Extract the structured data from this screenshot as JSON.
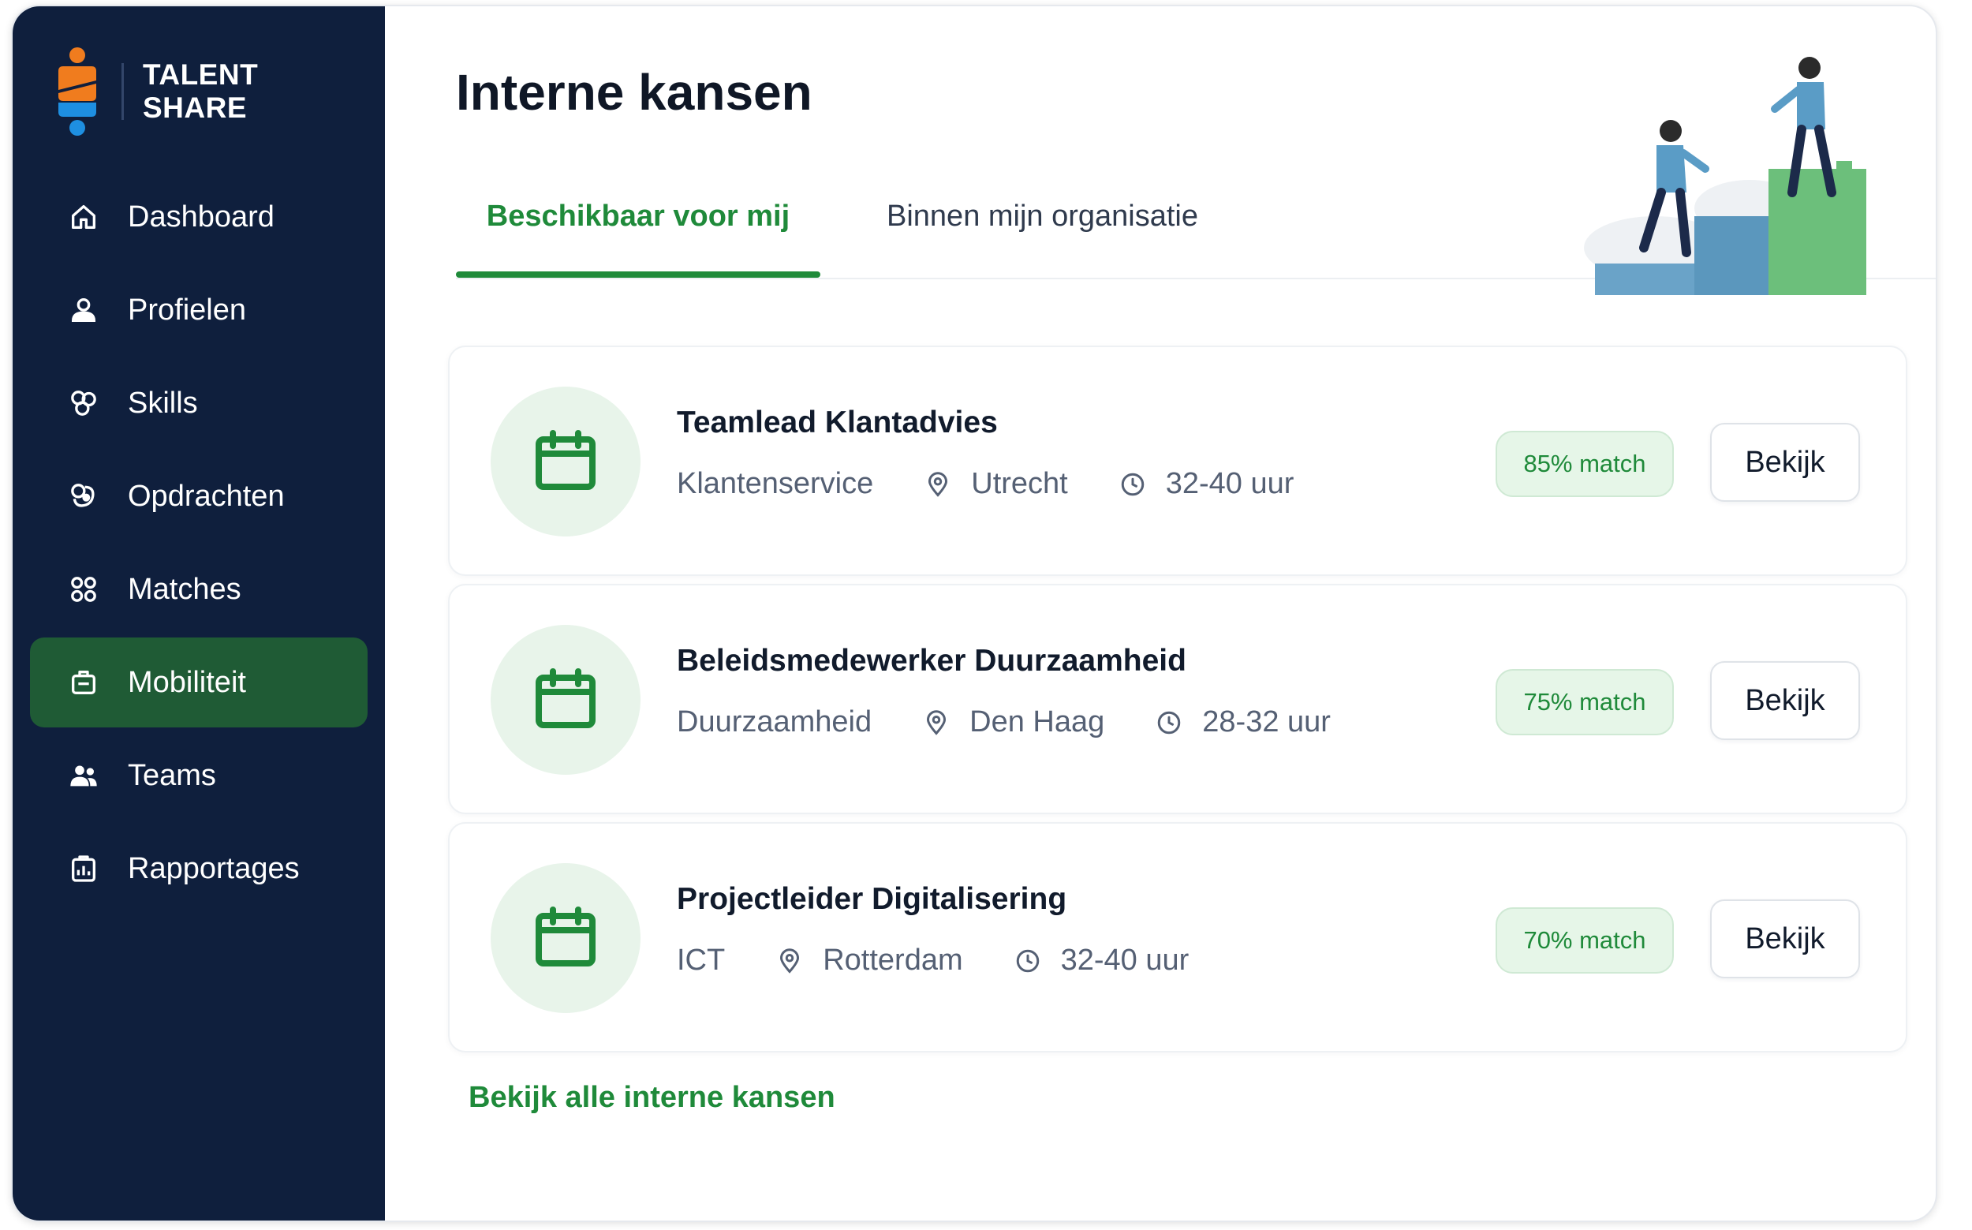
{
  "brand": {
    "name_line1": "TALENT",
    "name_line2": "SHARE"
  },
  "sidebar": {
    "items": [
      {
        "label": "Dashboard",
        "icon": "home-icon",
        "active": false
      },
      {
        "label": "Profielen",
        "icon": "profile-icon",
        "active": false
      },
      {
        "label": "Skills",
        "icon": "skills-icon",
        "active": false
      },
      {
        "label": "Opdrachten",
        "icon": "assignments-icon",
        "active": false
      },
      {
        "label": "Matches",
        "icon": "matches-icon",
        "active": false
      },
      {
        "label": "Mobiliteit",
        "icon": "briefcase-icon",
        "active": true
      },
      {
        "label": "Teams",
        "icon": "team-icon",
        "active": false
      },
      {
        "label": "Rapportages",
        "icon": "report-icon",
        "active": false
      }
    ]
  },
  "main": {
    "title": "Interne kansen",
    "tabs": [
      {
        "label": "Beschikbaar voor mij",
        "active": true
      },
      {
        "label": "Binnen mijn organisatie",
        "active": false
      }
    ],
    "opportunities": [
      {
        "title": "Teamlead Klantadvies",
        "department": "Klantenservice",
        "location": "Utrecht",
        "hours": "32-40 uur",
        "match": "85% match",
        "button": "Bekijk"
      },
      {
        "title": "Beleidsmedewerker Duurzaamheid",
        "department": "Duurzaamheid",
        "location": "Den Haag",
        "hours": "28-32 uur",
        "match": "75% match",
        "button": "Bekijk"
      },
      {
        "title": "Projectleider Digitalisering",
        "department": "ICT",
        "location": "Rotterdam",
        "hours": "32-40 uur",
        "match": "70% match",
        "button": "Bekijk"
      }
    ],
    "view_all_link": "Bekijk alle interne kansen"
  },
  "colors": {
    "sidebar_bg": "#0f1f3d",
    "active_nav_bg": "#1f5b35",
    "accent_green": "#1f8a3a",
    "logo_orange": "#f07c1e",
    "logo_blue": "#1e8fe1"
  }
}
